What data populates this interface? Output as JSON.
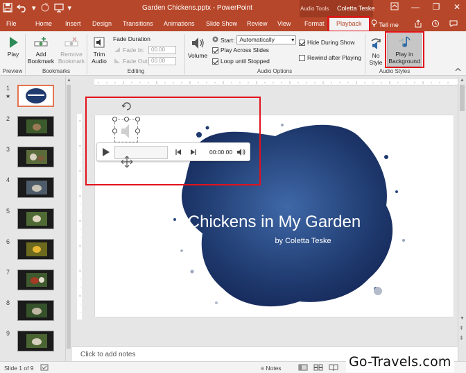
{
  "window": {
    "doc_title": "Garden Chickens.pptx - PowerPoint",
    "contextual_group": "Audio Tools",
    "user_name": "Coletta Teske",
    "controls": [
      "—",
      "❐",
      "✕"
    ]
  },
  "tabs": [
    {
      "label": "File"
    },
    {
      "label": "Home"
    },
    {
      "label": "Insert"
    },
    {
      "label": "Design"
    },
    {
      "label": "Transitions"
    },
    {
      "label": "Animations"
    },
    {
      "label": "Slide Show"
    },
    {
      "label": "Review"
    },
    {
      "label": "View"
    },
    {
      "label": "Format"
    },
    {
      "label": "Playback"
    }
  ],
  "tell_me": "Tell me",
  "ribbon": {
    "preview": {
      "play": "Play",
      "group": "Preview"
    },
    "bookmarks": {
      "add": "Add Bookmark",
      "remove": "Remove Bookmark",
      "group": "Bookmarks"
    },
    "editing": {
      "trim": "Trim Audio",
      "fade_duration": "Fade Duration",
      "fade_in_label": "Fade In:",
      "fade_in_value": "00.00",
      "fade_out_label": "Fade Out:",
      "fade_out_value": "00.00",
      "group": "Editing"
    },
    "audio_options": {
      "volume": "Volume",
      "start_label": "Start:",
      "start_value": "Automatically",
      "play_across": "Play Across Slides",
      "loop": "Loop until Stopped",
      "hide": "Hide During Show",
      "rewind": "Rewind after Playing",
      "group": "Audio Options"
    },
    "audio_styles": {
      "no_style": "No Style",
      "play_bg": "Play in Background",
      "group": "Audio Styles"
    }
  },
  "thumbnails": [
    "1",
    "2",
    "3",
    "4",
    "5",
    "6",
    "7",
    "8",
    "9"
  ],
  "slide": {
    "title": "Chickens in My Garden",
    "subtitle": "by Coletta Teske",
    "thumb_title": "Chickens in My Garden"
  },
  "player": {
    "time": "00:00.00"
  },
  "notes_placeholder": "Click to add notes",
  "status": {
    "slide_info": "Slide 1 of 9",
    "notes": "Notes"
  },
  "watermark": "Go-Travels.com",
  "colors": {
    "accent": "#b7472a",
    "highlight_box": "#e2121b",
    "slide_blob": "#1f3a6e"
  }
}
